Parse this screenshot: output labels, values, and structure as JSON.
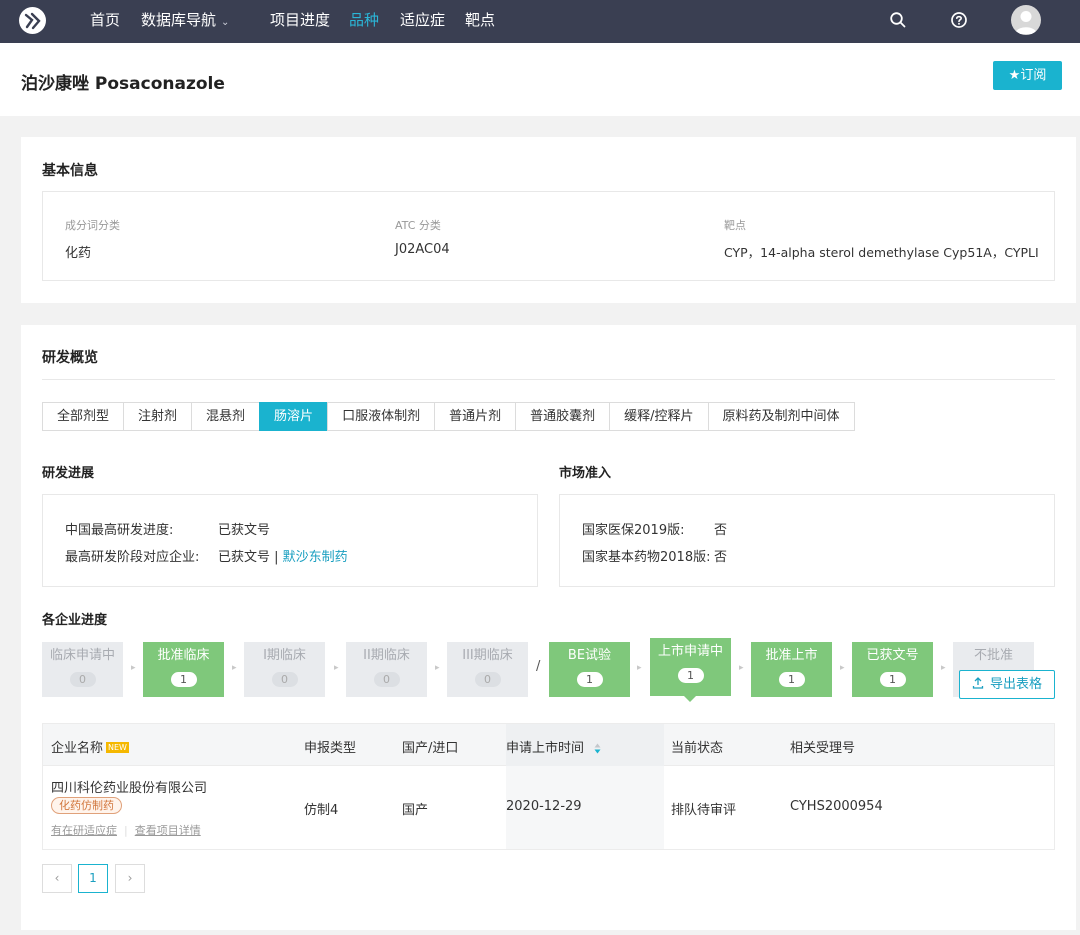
{
  "nav": {
    "items": [
      {
        "label": "首页"
      },
      {
        "label": "数据库导航"
      },
      {
        "label": "项目进度"
      },
      {
        "label": "品种"
      },
      {
        "label": "适应症"
      },
      {
        "label": "靶点"
      }
    ],
    "active": "品种",
    "accent_color": "#2bb5d6",
    "background": "#3a3f52",
    "icons": [
      "search-icon",
      "help-icon",
      "avatar"
    ]
  },
  "page": {
    "title": "泊沙康唑 Posaconazole",
    "subscribe_label": "★订阅"
  },
  "basic_info": {
    "title": "基本信息",
    "fields": [
      {
        "label": "成分词分类",
        "value": "化药"
      },
      {
        "label": "ATC 分类",
        "value": "J02AC04"
      },
      {
        "label": "靶点",
        "value": "CYP，14-alpha sterol demethylase Cyp51A，CYPLI"
      }
    ]
  },
  "overview": {
    "title": "研发概览",
    "tabs": [
      "全部剂型",
      "注射剂",
      "混悬剂",
      "肠溶片",
      "口服液体制剂",
      "普通片剂",
      "普通胶囊剂",
      "缓释/控释片",
      "原料药及制剂中间体"
    ],
    "active_tab": "肠溶片",
    "progress": {
      "title": "研发进展",
      "rows": [
        {
          "key": "中国最高研发进度:",
          "value": "已获文号"
        },
        {
          "key": "最高研发阶段对应企业:",
          "value": "已获文号",
          "sep": " | ",
          "link": "默沙东制药"
        }
      ]
    },
    "market": {
      "title": "市场准入",
      "rows": [
        {
          "key": "国家医保2019版:",
          "value": "否"
        },
        {
          "key": "国家基本药物2018版:",
          "value": "否"
        }
      ]
    }
  },
  "pipeline": {
    "title": "各企业进度",
    "stages": [
      {
        "name": "临床申请中",
        "count": "0",
        "active": false
      },
      {
        "name": "批准临床",
        "count": "1",
        "active": true
      },
      {
        "name": "I期临床",
        "count": "0",
        "active": false
      },
      {
        "name": "II期临床",
        "count": "0",
        "active": false
      },
      {
        "name": "III期临床",
        "count": "0",
        "active": false
      },
      {
        "name": "BE试验",
        "count": "1",
        "active": true
      },
      {
        "name": "上市申请中",
        "count": "1",
        "active": true,
        "current": true
      },
      {
        "name": "批准上市",
        "count": "1",
        "active": true
      },
      {
        "name": "已获文号",
        "count": "1",
        "active": true
      },
      {
        "name": "不批准",
        "count": "",
        "active": false
      }
    ],
    "slash": "/",
    "export_label": "导出表格"
  },
  "table": {
    "headers": {
      "company": "企业名称",
      "new_badge": "NEW",
      "type": "申报类型",
      "origin": "国产/进口",
      "date": "申请上市时间",
      "status": "当前状态",
      "acceptance": "相关受理号"
    },
    "rows": [
      {
        "company": "四川科伦药业股份有限公司",
        "tag": "化药仿制药",
        "link1": "有在研适应症",
        "link2": "查看项目详情",
        "type": "仿制4",
        "origin": "国产",
        "date": "2020-12-29",
        "status": "排队待审评",
        "acceptance": "CYHS2000954"
      }
    ]
  },
  "pagination": {
    "prev": "‹",
    "current": "1",
    "next": "›"
  }
}
